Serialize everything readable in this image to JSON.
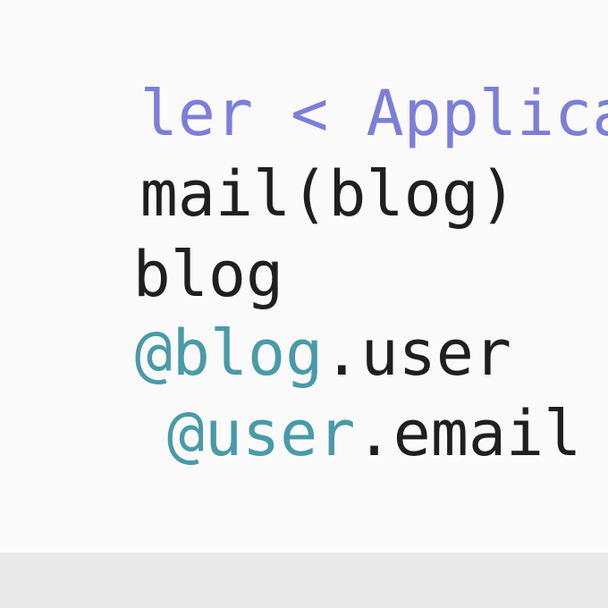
{
  "editor": {
    "colors": {
      "background": "#fafafa",
      "plain_text": "#1f1f1f",
      "constant": "#7b7fd8",
      "instance_variable": "#4a9aa8",
      "bottom_bar": "#e9e9e9"
    },
    "lines": [
      [
        {
          "text": "ler < ApplicationM",
          "kind": "const"
        }
      ],
      [
        {
          "text": "mail(blog)",
          "kind": "plain"
        }
      ],
      [
        {
          "text": "blog",
          "kind": "plain"
        }
      ],
      [
        {
          "text": "@blog",
          "kind": "ivar"
        },
        {
          "text": ".user",
          "kind": "plain"
        }
      ],
      [
        {
          "text": " ",
          "kind": "plain"
        },
        {
          "text": "@user",
          "kind": "ivar"
        },
        {
          "text": ".email ,subj",
          "kind": "plain"
        }
      ]
    ]
  }
}
